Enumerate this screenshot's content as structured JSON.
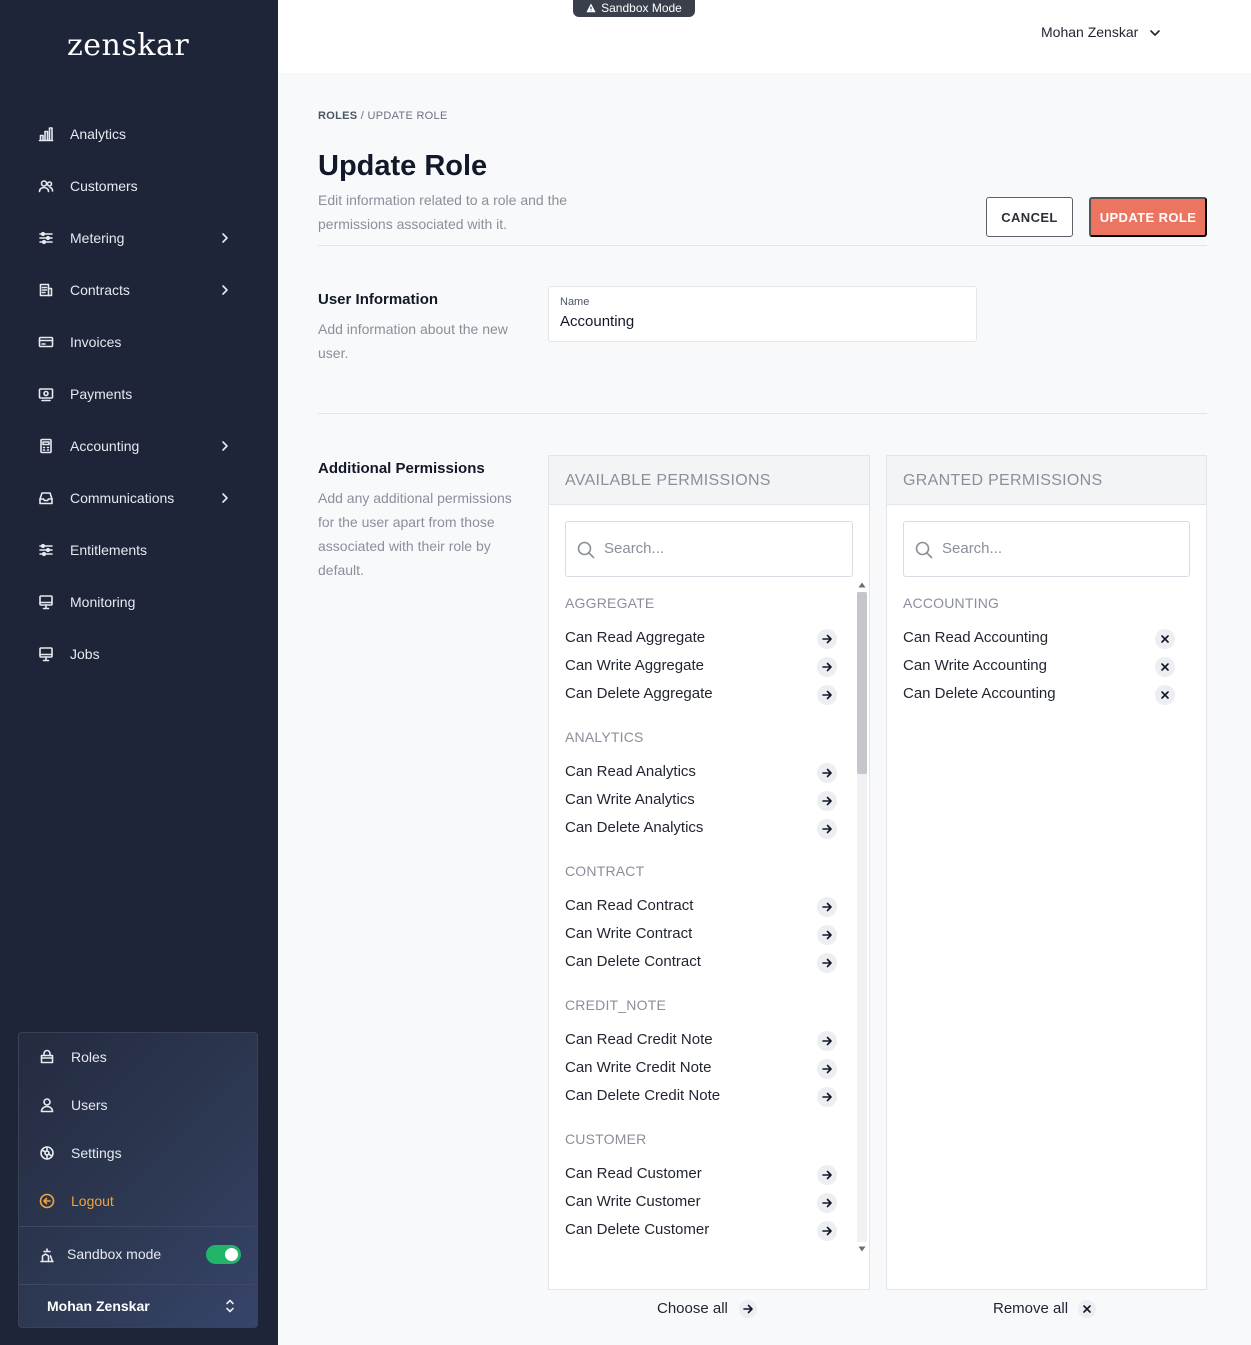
{
  "sidebar": {
    "logo": "zenskar",
    "nav": [
      {
        "label": "Analytics",
        "icon": "bar-chart-icon",
        "chevron": false
      },
      {
        "label": "Customers",
        "icon": "users-icon",
        "chevron": false
      },
      {
        "label": "Metering",
        "icon": "sliders-icon",
        "chevron": true
      },
      {
        "label": "Contracts",
        "icon": "contract-icon",
        "chevron": true
      },
      {
        "label": "Invoices",
        "icon": "credit-card-icon",
        "chevron": false
      },
      {
        "label": "Payments",
        "icon": "payments-icon",
        "chevron": false
      },
      {
        "label": "Accounting",
        "icon": "calculator-icon",
        "chevron": true
      },
      {
        "label": "Communications",
        "icon": "inbox-icon",
        "chevron": true
      },
      {
        "label": "Entitlements",
        "icon": "sliders-icon",
        "chevron": false
      },
      {
        "label": "Monitoring",
        "icon": "monitor-icon",
        "chevron": false
      },
      {
        "label": "Jobs",
        "icon": "monitor-icon",
        "chevron": false
      }
    ],
    "bottom": {
      "roles": "Roles",
      "users": "Users",
      "settings": "Settings",
      "logout": "Logout",
      "sandbox_mode": "Sandbox mode",
      "sandbox_enabled": true,
      "user_name": "Mohan Zenskar"
    }
  },
  "header": {
    "sandbox_badge": "Sandbox Mode",
    "user_name": "Mohan Zenskar"
  },
  "page": {
    "breadcrumb_root": "ROLES",
    "breadcrumb_sep": " / ",
    "breadcrumb_current": "UPDATE ROLE",
    "title": "Update Role",
    "subtitle": "Edit information related to a role and the permissions associated with it.",
    "cancel_label": "CANCEL",
    "update_label": "UPDATE ROLE"
  },
  "user_info": {
    "title": "User Information",
    "description": "Add information about the new user.",
    "name_label": "Name",
    "name_value": "Accounting"
  },
  "permissions": {
    "title": "Additional Permissions",
    "description": "Add any additional permissions for the user apart from those associated with their role by default.",
    "available": {
      "title": "AVAILABLE PERMISSIONS",
      "search_placeholder": "Search...",
      "groups": [
        {
          "name": "AGGREGATE",
          "items": [
            "Can Read Aggregate",
            "Can Write Aggregate",
            "Can Delete Aggregate"
          ]
        },
        {
          "name": "ANALYTICS",
          "items": [
            "Can Read Analytics",
            "Can Write Analytics",
            "Can Delete Analytics"
          ]
        },
        {
          "name": "CONTRACT",
          "items": [
            "Can Read Contract",
            "Can Write Contract",
            "Can Delete Contract"
          ]
        },
        {
          "name": "CREDIT_NOTE",
          "items": [
            "Can Read Credit Note",
            "Can Write Credit Note",
            "Can Delete Credit Note"
          ]
        },
        {
          "name": "CUSTOMER",
          "items": [
            "Can Read Customer",
            "Can Write Customer",
            "Can Delete Customer"
          ]
        }
      ],
      "choose_all": "Choose all"
    },
    "granted": {
      "title": "GRANTED PERMISSIONS",
      "search_placeholder": "Search...",
      "groups": [
        {
          "name": "ACCOUNTING",
          "items": [
            "Can Read Accounting",
            "Can Write Accounting",
            "Can Delete Accounting"
          ]
        }
      ],
      "remove_all": "Remove all"
    }
  }
}
